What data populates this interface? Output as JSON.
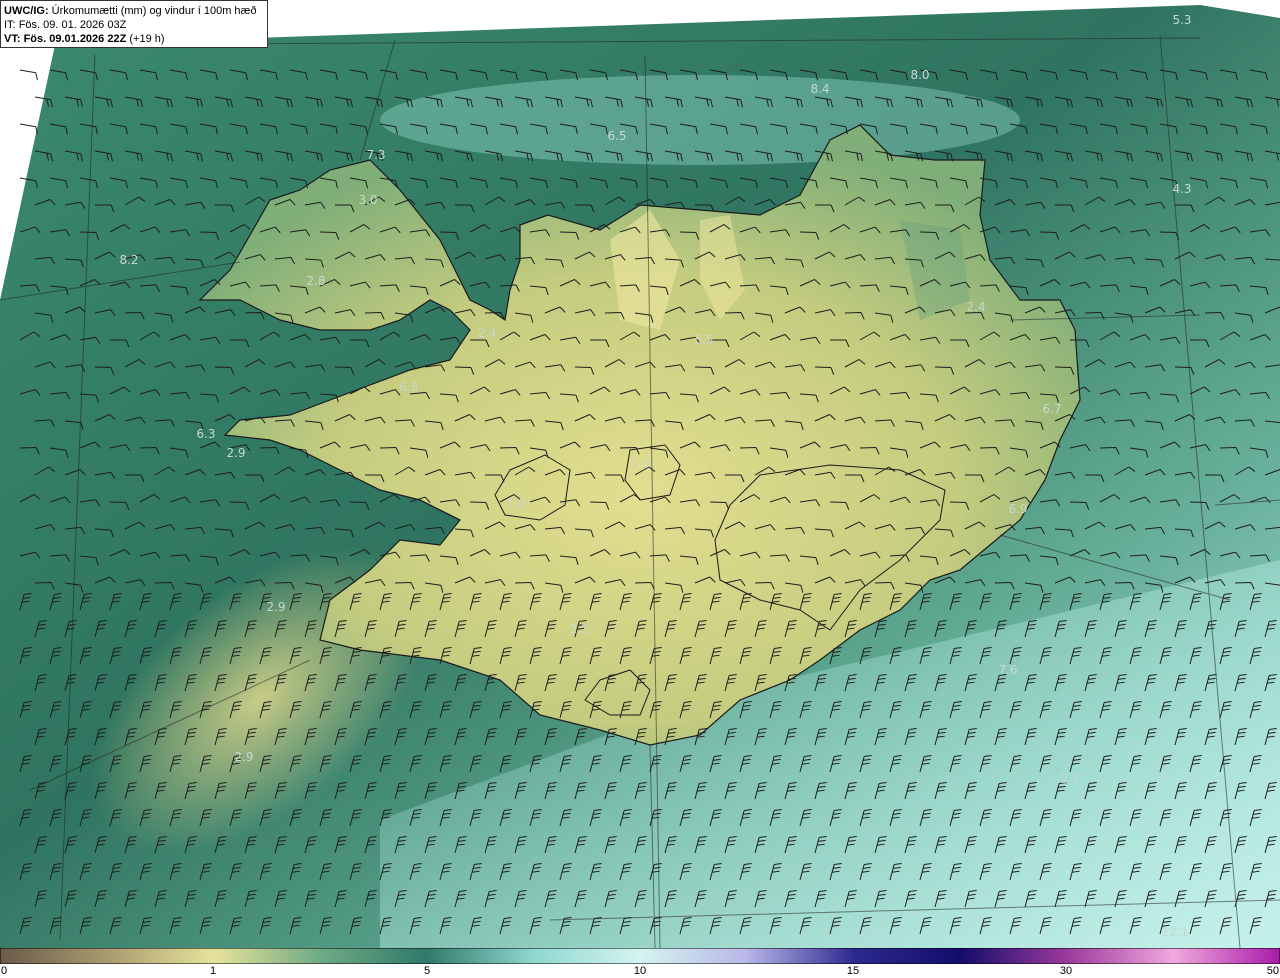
{
  "header": {
    "product": "UWC/IG:",
    "title": "Úrkomumætti (mm) og vindur í 100m hæð",
    "it_label": "IT:",
    "it_value": "Fös. 09. 01. 2026 03Z",
    "vt_label": "VT:",
    "vt_value": "Fös. 09.01.2026 22Z",
    "vt_offset": "(+19 h)"
  },
  "map_values": [
    "5.3",
    "8.4",
    "8.0",
    "6.5",
    "7.3",
    "3.0",
    "8.2",
    "2.8",
    "4.3",
    "2.4",
    "2.4",
    "5.5",
    "6.8",
    "6.3",
    "2.9",
    "6.7",
    "1.0",
    "1.0",
    "6.9",
    "2.9",
    "2.1",
    "7.6",
    "2.9",
    "5.7",
    "12.1"
  ],
  "colorbar": {
    "ticks": [
      "0",
      "1",
      "5",
      "10",
      "15",
      "30",
      "50"
    ],
    "colors": [
      "#6b5a4a",
      "#a99a6e",
      "#e6e39a",
      "#6faa84",
      "#2f7a6a",
      "#8fd7cf",
      "#d4f4ef",
      "#b9b6e8",
      "#2d2a8f",
      "#140c6a",
      "#9a3a9c",
      "#f0a8dd",
      "#a81aa8"
    ]
  },
  "map_colors": {
    "ocean_dark": "#2d6f5d",
    "ocean_mid": "#4f9a84",
    "ocean_light": "#9fe0d6",
    "land_low": "#c9d07e",
    "land_high": "#e2dd8f",
    "coastline": "#1a1a1a"
  }
}
